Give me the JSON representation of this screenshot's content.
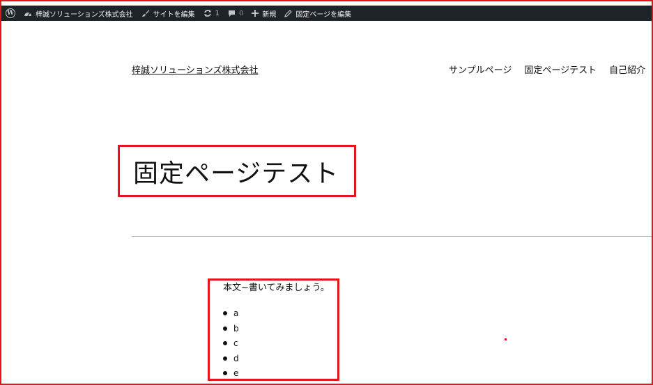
{
  "admin_bar": {
    "site_name": "梓誠ソリューションズ株式会社",
    "edit_site": "サイトを編集",
    "updates_count": "1",
    "comments_count": "0",
    "new_label": "新規",
    "edit_page": "固定ページを編集"
  },
  "header": {
    "site_title": "梓誠ソリューションズ株式会社",
    "nav": [
      "サンプルページ",
      "固定ページテスト",
      "自己紹介"
    ]
  },
  "page": {
    "title": "固定ページテスト",
    "body_text": "本文~書いてみましょう。",
    "list_items": [
      "a",
      "b",
      "c",
      "d",
      "e"
    ]
  },
  "colors": {
    "admin_bar_bg": "#1d2327",
    "highlight_red": "#e4161d"
  }
}
